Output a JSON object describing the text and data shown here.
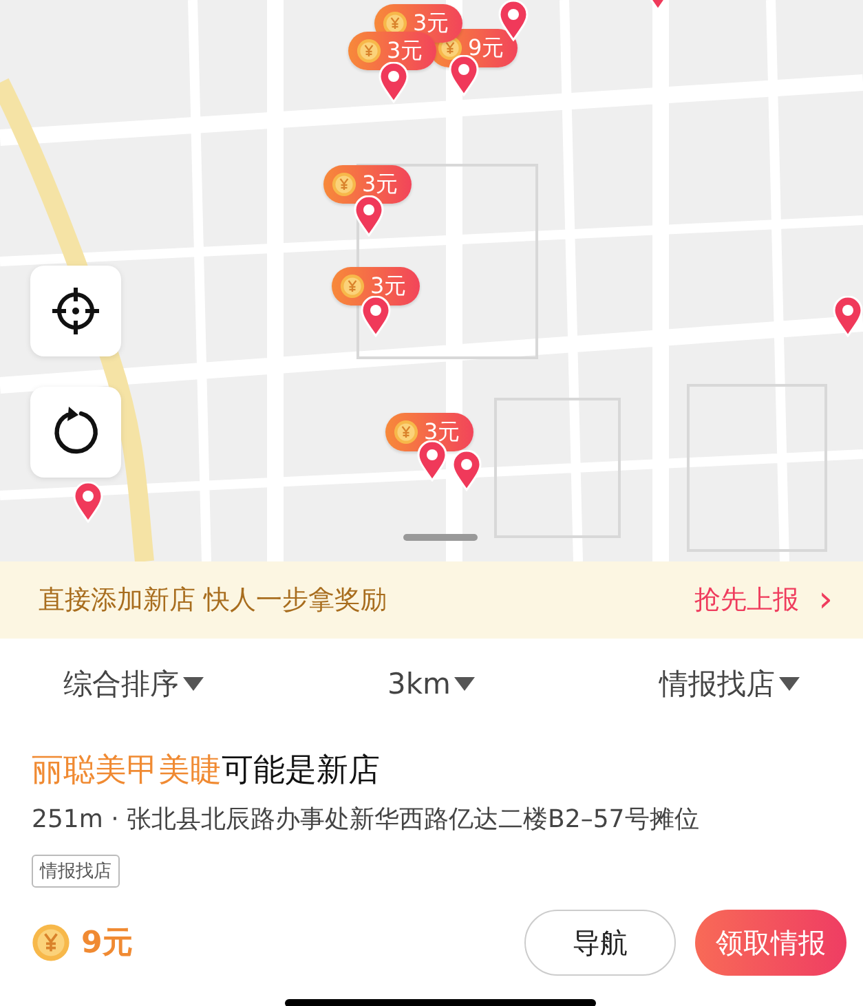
{
  "map": {
    "markers": [
      {
        "price": "9元"
      },
      {
        "price": "3元"
      },
      {
        "price": "3元"
      },
      {
        "price": "3元"
      },
      {
        "price": "3元"
      },
      {
        "price": "3元"
      }
    ]
  },
  "banner": {
    "text": "直接添加新店 快人一步拿奖励",
    "action": "抢先上报",
    "chevron": "›"
  },
  "filters": [
    {
      "label": "综合排序"
    },
    {
      "label": "3km"
    },
    {
      "label": "情报找店"
    }
  ],
  "shop": {
    "name": "丽聪美甲美睫",
    "note": "可能是新店",
    "address": "251m · 张北县北辰路办事处新华西路亿达二楼B2–57号摊位",
    "tag": "情报找店",
    "reward": "9元",
    "buttons": [
      {
        "label": "导航",
        "kind": "outline"
      },
      {
        "label": "领取情报",
        "kind": "primary"
      }
    ]
  }
}
